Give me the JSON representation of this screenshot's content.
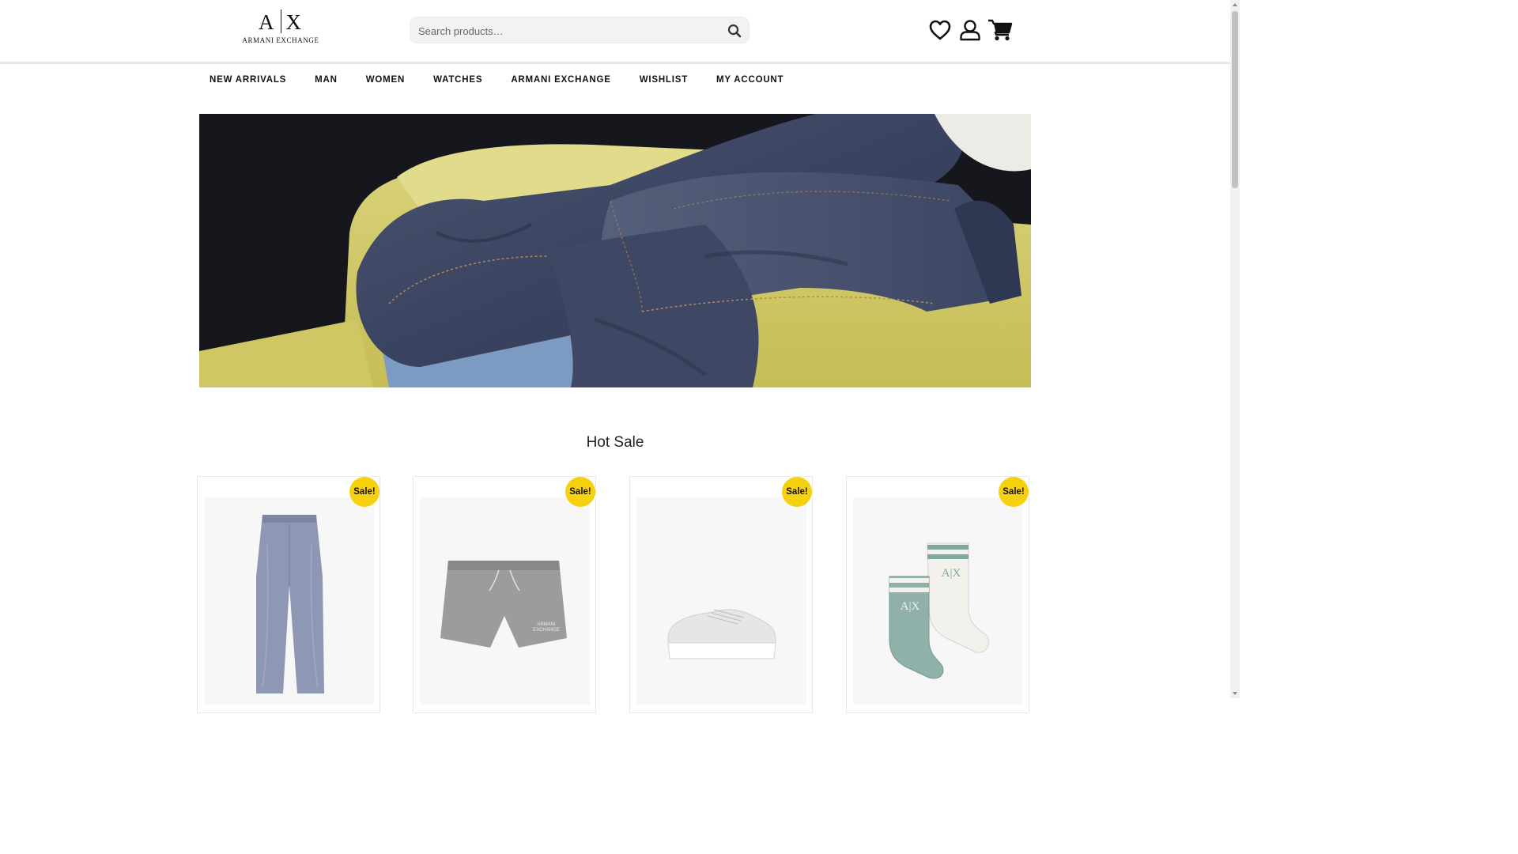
{
  "brand": {
    "logo_mark": "A|X",
    "logo_left": "A",
    "logo_right": "X",
    "logo_sub": "ARMANI EXCHANGE"
  },
  "search": {
    "placeholder": "Search products…",
    "icon": "search-icon"
  },
  "header_icons": [
    {
      "name": "wishlist-heart-icon"
    },
    {
      "name": "account-user-icon"
    },
    {
      "name": "cart-icon"
    }
  ],
  "nav": {
    "items": [
      {
        "label": "NEW ARRIVALS"
      },
      {
        "label": "MAN"
      },
      {
        "label": "WOMEN"
      },
      {
        "label": "WATCHES"
      },
      {
        "label": "ARMANI EXCHANGE"
      },
      {
        "label": "WISHLIST"
      },
      {
        "label": "MY ACCOUNT"
      }
    ]
  },
  "hero": {
    "image": "denim-jeans-on-yellow-sofa"
  },
  "hot_sale": {
    "title": "Hot Sale",
    "products": [
      {
        "badge": "Sale!",
        "image": "blue-linen-wide-trousers"
      },
      {
        "badge": "Sale!",
        "image": "grey-swim-shorts"
      },
      {
        "badge": "Sale!",
        "image": "white-platform-sneaker"
      },
      {
        "badge": "Sale!",
        "image": "ax-sport-socks"
      }
    ]
  },
  "colors": {
    "accent_badge": "#f5d10f",
    "text": "#111111",
    "search_bg": "#f2f2f2"
  }
}
